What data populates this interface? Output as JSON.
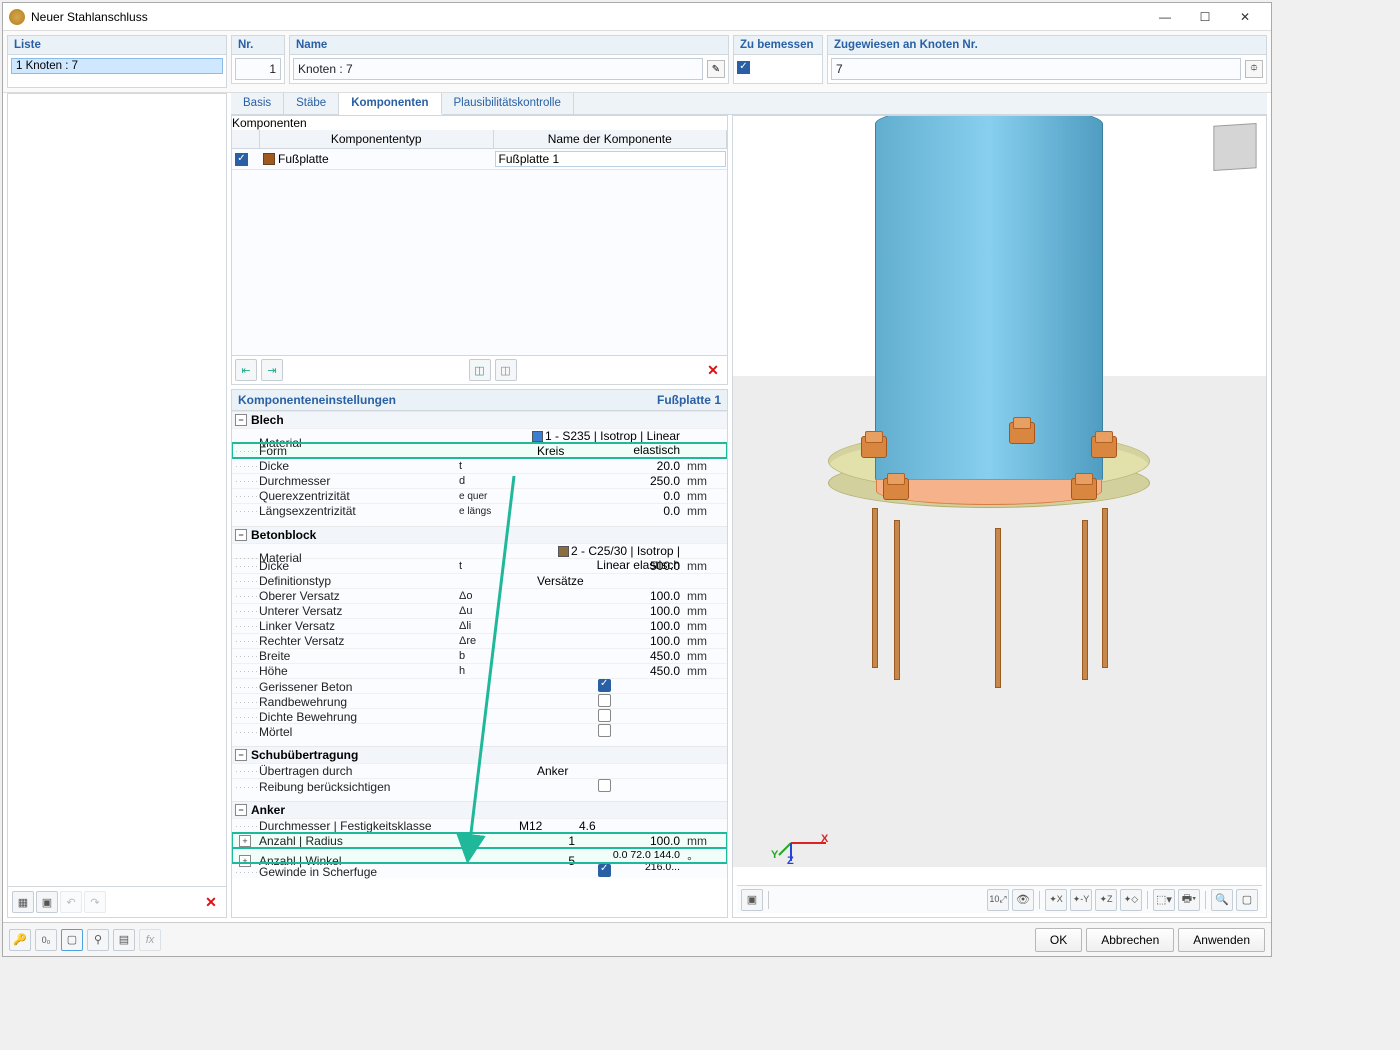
{
  "window": {
    "title": "Neuer Stahlanschluss"
  },
  "top": {
    "liste": {
      "hdr": "Liste",
      "row": "1  Knoten : 7"
    },
    "nr": {
      "hdr": "Nr.",
      "val": "1"
    },
    "name": {
      "hdr": "Name",
      "val": "Knoten : 7"
    },
    "bemessen": {
      "hdr": "Zu bemessen"
    },
    "knoten": {
      "hdr": "Zugewiesen an Knoten Nr.",
      "val": "7"
    }
  },
  "tabs": {
    "t0": "Basis",
    "t1": "Stäbe",
    "t2": "Komponenten",
    "t3": "Plausibilitätskontrolle"
  },
  "komp": {
    "hdr": "Komponenten",
    "col1": "Komponententyp",
    "col2": "Name der Komponente",
    "rowType": "Fußplatte",
    "rowName": "Fußplatte 1"
  },
  "settings": {
    "hdr": "Komponenteneinstellungen",
    "sub": "Fußplatte 1",
    "sec_blech": "Blech",
    "blech": {
      "material_l": "Material",
      "material_v": "1 - S235 | Isotrop | Linear elastisch",
      "form_l": "Form",
      "form_v": "Kreis",
      "dicke_l": "Dicke",
      "dicke_s": "t",
      "dicke_v": "20.0",
      "dicke_u": "mm",
      "durch_l": "Durchmesser",
      "durch_s": "d",
      "durch_v": "250.0",
      "durch_u": "mm",
      "quer_l": "Querexzentrizität",
      "quer_s": "e quer",
      "quer_v": "0.0",
      "quer_u": "mm",
      "laengs_l": "Längsexzentrizität",
      "laengs_s": "e längs",
      "laengs_v": "0.0",
      "laengs_u": "mm"
    },
    "sec_beton": "Betonblock",
    "beton": {
      "material_l": "Material",
      "material_v": "2 - C25/30 | Isotrop | Linear elastisch",
      "dicke_l": "Dicke",
      "dicke_s": "t",
      "dicke_v": "500.0",
      "dicke_u": "mm",
      "def_l": "Definitionstyp",
      "def_v": "Versätze",
      "ov_l": "Oberer Versatz",
      "ov_s": "Δo",
      "ov_v": "100.0",
      "ov_u": "mm",
      "uv_l": "Unterer Versatz",
      "uv_s": "Δu",
      "uv_v": "100.0",
      "uv_u": "mm",
      "lv_l": "Linker Versatz",
      "lv_s": "Δli",
      "lv_v": "100.0",
      "lv_u": "mm",
      "rv_l": "Rechter Versatz",
      "rv_s": "Δre",
      "rv_v": "100.0",
      "rv_u": "mm",
      "b_l": "Breite",
      "b_s": "b",
      "b_v": "450.0",
      "b_u": "mm",
      "h_l": "Höhe",
      "h_s": "h",
      "h_v": "450.0",
      "h_u": "mm",
      "ger_l": "Gerissener Beton",
      "rand_l": "Randbewehrung",
      "dichte_l": "Dichte Bewehrung",
      "moertel_l": "Mörtel"
    },
    "sec_schub": "Schubübertragung",
    "schub": {
      "ueber_l": "Übertragen durch",
      "ueber_v": "Anker",
      "reib_l": "Reibung berücksichtigen"
    },
    "sec_anker": "Anker",
    "anker": {
      "durch_l": "Durchmesser | Festigkeitsklasse",
      "durch_v1": "M12",
      "durch_v2": "4.6",
      "anzR_l": "Anzahl | Radius",
      "anzR_v1": "1",
      "anzR_v2": "100.0",
      "anzR_u": "mm",
      "anzW_l": "Anzahl | Winkel",
      "anzW_v1": "5",
      "anzW_v2": "0.0 72.0 144.0 216.0...",
      "anzW_u": "°",
      "gewinde_l": "Gewinde in Scherfuge"
    }
  },
  "buttons": {
    "ok": "OK",
    "cancel": "Abbrechen",
    "apply": "Anwenden"
  },
  "axis": {
    "x": "X",
    "y": "Y",
    "z": "Z"
  }
}
